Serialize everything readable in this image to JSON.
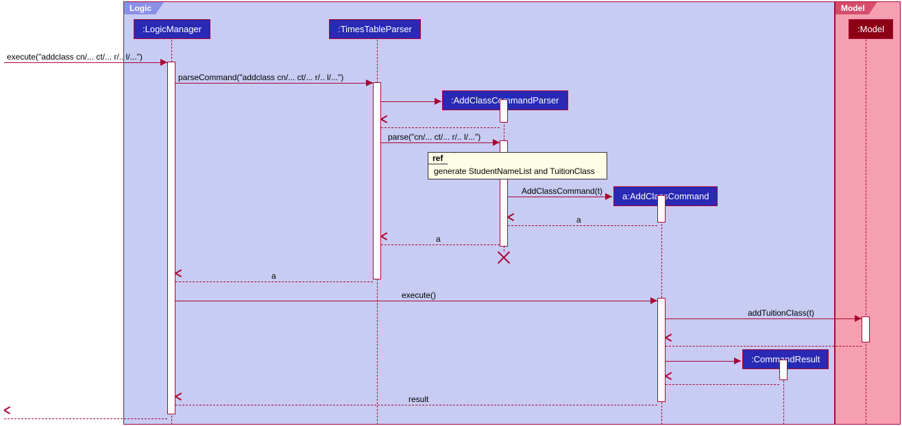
{
  "frames": {
    "logic": {
      "title": "Logic"
    },
    "model": {
      "title": "Model"
    }
  },
  "lifelines": {
    "logicManager": ":LogicManager",
    "timesTableParser": ":TimesTableParser",
    "addClassCommandParser": ":AddClassCommandParser",
    "addClassCommand": "a:AddClassCommand",
    "commandResult": ":CommandResult",
    "model": ":Model"
  },
  "messages": {
    "m1": "execute(\"addclass cn/... ct/... r/.. l/...\")",
    "m2": "parseCommand(\"addclass cn/... ct/... r/.. l/...\")",
    "m3": "parse(\"cn/... ct/... r/.. l/...\")",
    "m4": "AddClassCommand(t)",
    "m5": "a",
    "m6": "a",
    "m7": "a",
    "m8": "execute()",
    "m9": "addTuitionClass(t)",
    "m10": "result"
  },
  "ref": {
    "tag": "ref",
    "body": "generate StudentNameList and TuitionClass"
  }
}
